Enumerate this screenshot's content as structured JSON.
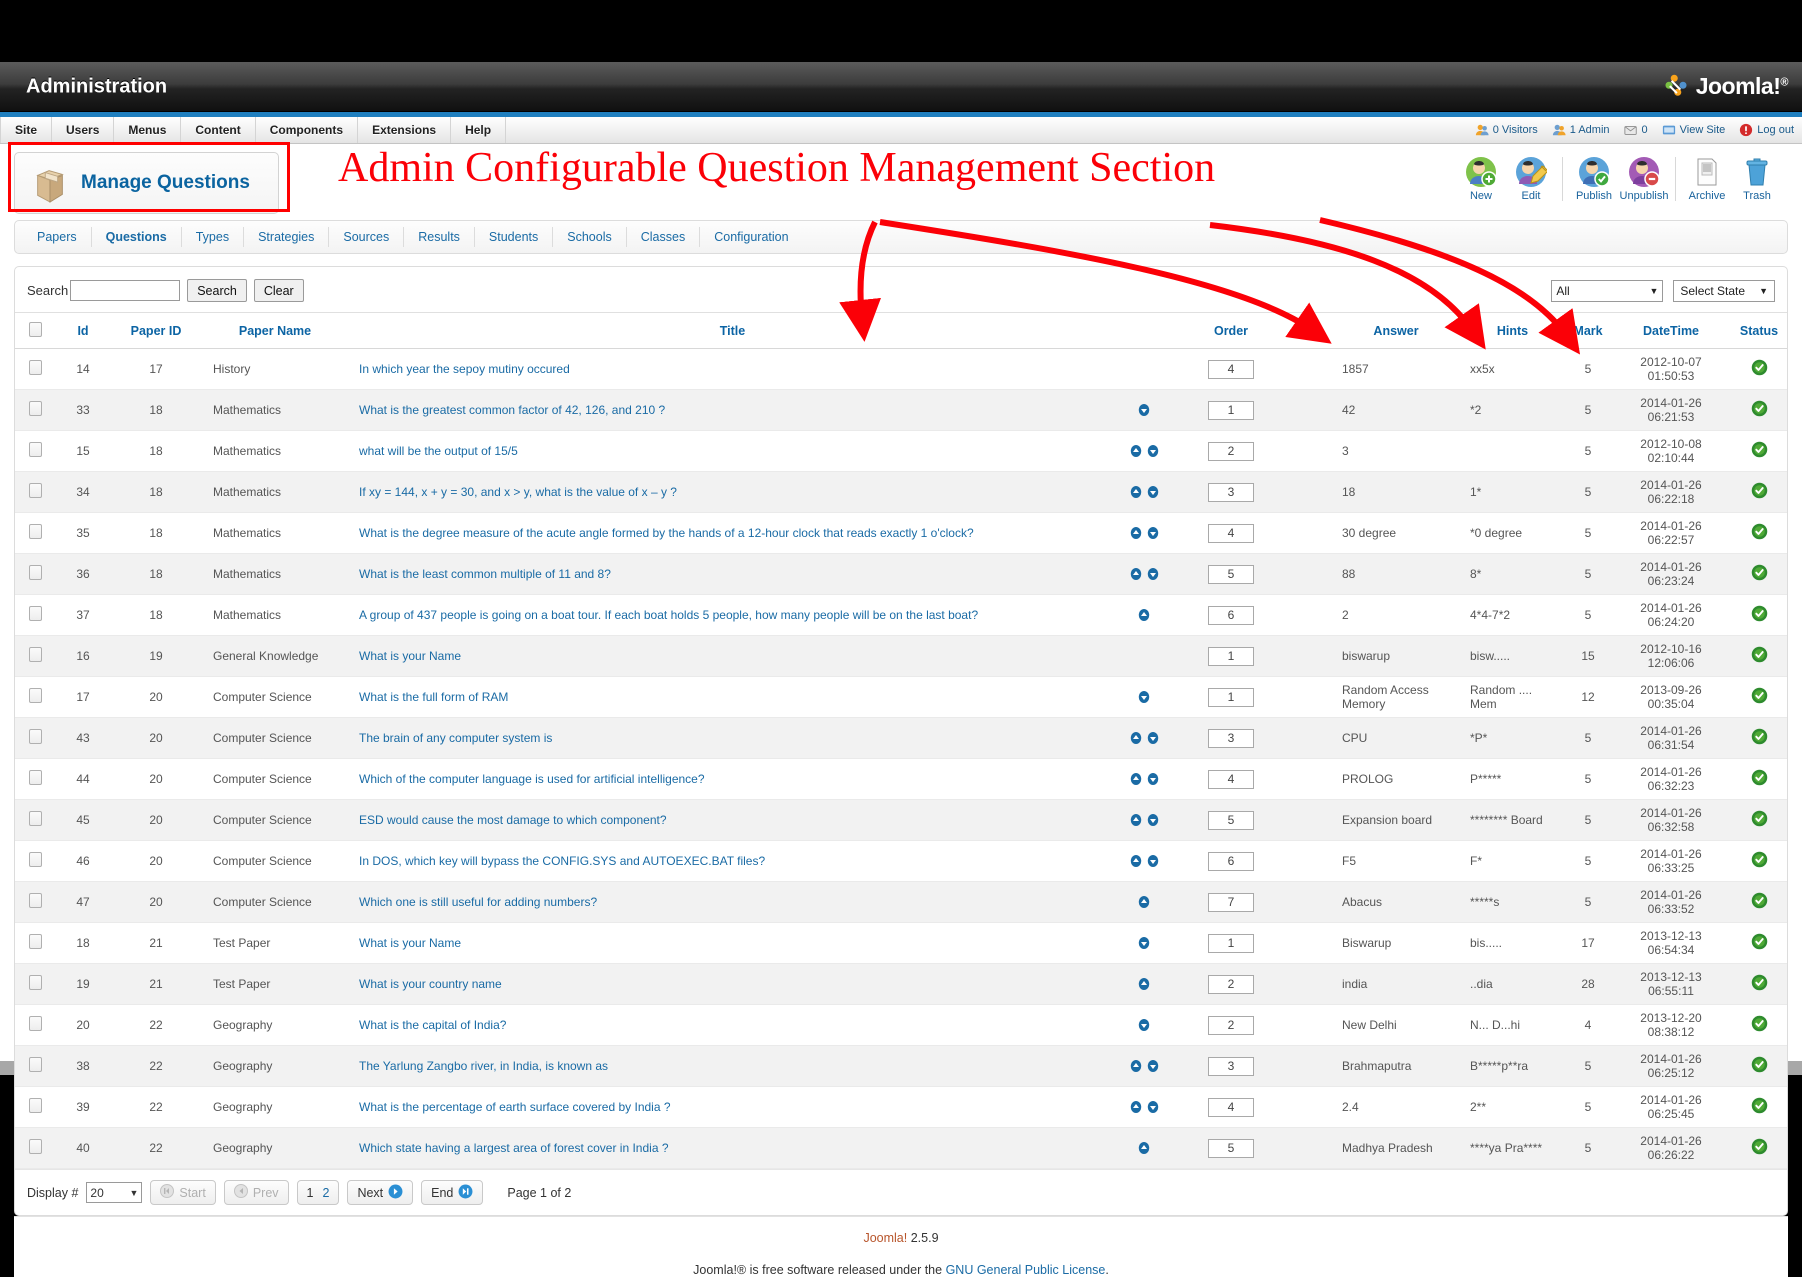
{
  "header": {
    "title": "Administration",
    "brand": "Joomla!",
    "brand_sup": "®"
  },
  "menu": {
    "items": [
      {
        "label": "Site"
      },
      {
        "label": "Users"
      },
      {
        "label": "Menus"
      },
      {
        "label": "Content"
      },
      {
        "label": "Components"
      },
      {
        "label": "Extensions"
      },
      {
        "label": "Help"
      }
    ],
    "status": [
      {
        "label": "0 Visitors",
        "icon": "visitors-icon"
      },
      {
        "label": "1 Admin",
        "icon": "admin-icon"
      },
      {
        "label": "0",
        "icon": "messages-icon"
      },
      {
        "label": "View Site",
        "icon": "view-site-icon"
      },
      {
        "label": "Log out",
        "icon": "logout-icon"
      }
    ]
  },
  "page": {
    "title": "Manage Questions",
    "icon": "box-icon",
    "annotation": "Admin Configurable Question Management Section"
  },
  "toolbar": {
    "buttons": [
      {
        "label": "New",
        "icon": "user-plus-icon"
      },
      {
        "label": "Edit",
        "icon": "user-edit-icon"
      },
      {
        "label": "Publish",
        "icon": "user-check-icon"
      },
      {
        "label": "Unpublish",
        "icon": "user-minus-icon"
      },
      {
        "label": "Archive",
        "icon": "archive-icon"
      },
      {
        "label": "Trash",
        "icon": "trash-icon"
      }
    ]
  },
  "submenu": {
    "tabs": [
      {
        "label": "Papers",
        "active": false
      },
      {
        "label": "Questions",
        "active": true
      },
      {
        "label": "Types",
        "active": false
      },
      {
        "label": "Strategies",
        "active": false
      },
      {
        "label": "Sources",
        "active": false
      },
      {
        "label": "Results",
        "active": false
      },
      {
        "label": "Students",
        "active": false
      },
      {
        "label": "Schools",
        "active": false
      },
      {
        "label": "Classes",
        "active": false
      },
      {
        "label": "Configuration",
        "active": false
      }
    ]
  },
  "filters": {
    "search_label": "Search",
    "search_value": "",
    "search_placeholder": "",
    "search_button": "Search",
    "clear_button": "Clear",
    "paper_select": "All",
    "state_select": "Select State"
  },
  "table": {
    "columns": [
      "",
      "Id",
      "Paper ID",
      "Paper Name",
      "Title",
      "",
      "Order",
      "",
      "Answer",
      "Hints",
      "Mark",
      "DateTime",
      "Status"
    ],
    "headers": {
      "id": "Id",
      "paper_id": "Paper ID",
      "paper_name": "Paper Name",
      "title": "Title",
      "order": "Order",
      "save_icon": "save-order-icon",
      "answer": "Answer",
      "hints": "Hints",
      "mark": "Mark",
      "datetime": "DateTime",
      "status": "Status"
    },
    "rows": [
      {
        "id": "14",
        "paper_id": "17",
        "paper_name": "History",
        "title": "In which year the sepoy mutiny occured",
        "up": false,
        "down": false,
        "order": "4",
        "answer": "1857",
        "hints": "xx5x",
        "mark": "5",
        "datetime": "2012-10-07 01:50:53",
        "status": "published"
      },
      {
        "id": "33",
        "paper_id": "18",
        "paper_name": "Mathematics",
        "title": "What is the greatest common factor of 42, 126, and 210 ?",
        "up": false,
        "down": true,
        "order": "1",
        "answer": "42",
        "hints": "*2",
        "mark": "5",
        "datetime": "2014-01-26 06:21:53",
        "status": "published"
      },
      {
        "id": "15",
        "paper_id": "18",
        "paper_name": "Mathematics",
        "title": "what will be the output of 15/5",
        "up": true,
        "down": true,
        "order": "2",
        "answer": "3",
        "hints": "",
        "mark": "5",
        "datetime": "2012-10-08 02:10:44",
        "status": "published"
      },
      {
        "id": "34",
        "paper_id": "18",
        "paper_name": "Mathematics",
        "title": "If xy = 144, x + y = 30, and x > y, what is the value of x – y ?",
        "up": true,
        "down": true,
        "order": "3",
        "answer": "18",
        "hints": "1*",
        "mark": "5",
        "datetime": "2014-01-26 06:22:18",
        "status": "published"
      },
      {
        "id": "35",
        "paper_id": "18",
        "paper_name": "Mathematics",
        "title": "What is the degree measure of the acute angle formed by the hands of a 12-hour clock that reads exactly 1 o'clock?",
        "up": true,
        "down": true,
        "order": "4",
        "answer": "30 degree",
        "hints": "*0 degree",
        "mark": "5",
        "datetime": "2014-01-26 06:22:57",
        "status": "published"
      },
      {
        "id": "36",
        "paper_id": "18",
        "paper_name": "Mathematics",
        "title": "What is the least common multiple of 11 and 8?",
        "up": true,
        "down": true,
        "order": "5",
        "answer": "88",
        "hints": "8*",
        "mark": "5",
        "datetime": "2014-01-26 06:23:24",
        "status": "published"
      },
      {
        "id": "37",
        "paper_id": "18",
        "paper_name": "Mathematics",
        "title": "A group of 437 people is going on a boat tour. If each boat holds 5 people, how many people will be on the last boat?",
        "up": true,
        "down": false,
        "order": "6",
        "answer": "2",
        "hints": "4*4-7*2",
        "mark": "5",
        "datetime": "2014-01-26 06:24:20",
        "status": "published"
      },
      {
        "id": "16",
        "paper_id": "19",
        "paper_name": "General Knowledge",
        "title": "What is your Name",
        "up": false,
        "down": false,
        "order": "1",
        "answer": "biswarup",
        "hints": "bisw.....",
        "mark": "15",
        "datetime": "2012-10-16 12:06:06",
        "status": "published"
      },
      {
        "id": "17",
        "paper_id": "20",
        "paper_name": "Computer Science",
        "title": "What is the full form of RAM",
        "up": false,
        "down": true,
        "order": "1",
        "answer": "Random Access Memory",
        "hints": "Random .... Mem",
        "mark": "12",
        "datetime": "2013-09-26 00:35:04",
        "status": "published"
      },
      {
        "id": "43",
        "paper_id": "20",
        "paper_name": "Computer Science",
        "title": "The brain of any computer system is",
        "up": true,
        "down": true,
        "order": "3",
        "answer": "CPU",
        "hints": "*P*",
        "mark": "5",
        "datetime": "2014-01-26 06:31:54",
        "status": "published"
      },
      {
        "id": "44",
        "paper_id": "20",
        "paper_name": "Computer Science",
        "title": "Which of the computer language is used for artificial intelligence?",
        "up": true,
        "down": true,
        "order": "4",
        "answer": "PROLOG",
        "hints": "P*****",
        "mark": "5",
        "datetime": "2014-01-26 06:32:23",
        "status": "published"
      },
      {
        "id": "45",
        "paper_id": "20",
        "paper_name": "Computer Science",
        "title": "ESD would cause the most damage to which component?",
        "up": true,
        "down": true,
        "order": "5",
        "answer": "Expansion board",
        "hints": "******** Board",
        "mark": "5",
        "datetime": "2014-01-26 06:32:58",
        "status": "published"
      },
      {
        "id": "46",
        "paper_id": "20",
        "paper_name": "Computer Science",
        "title": "In DOS, which key will bypass the CONFIG.SYS and AUTOEXEC.BAT files?",
        "up": true,
        "down": true,
        "order": "6",
        "answer": "F5",
        "hints": "F*",
        "mark": "5",
        "datetime": "2014-01-26 06:33:25",
        "status": "published"
      },
      {
        "id": "47",
        "paper_id": "20",
        "paper_name": "Computer Science",
        "title": "Which one is still useful for adding numbers?",
        "up": true,
        "down": false,
        "order": "7",
        "answer": "Abacus",
        "hints": "*****s",
        "mark": "5",
        "datetime": "2014-01-26 06:33:52",
        "status": "published"
      },
      {
        "id": "18",
        "paper_id": "21",
        "paper_name": "Test Paper",
        "title": "What is your Name",
        "up": false,
        "down": true,
        "order": "1",
        "answer": "Biswarup",
        "hints": "bis.....",
        "mark": "17",
        "datetime": "2013-12-13 06:54:34",
        "status": "published"
      },
      {
        "id": "19",
        "paper_id": "21",
        "paper_name": "Test Paper",
        "title": "What is your country name",
        "up": true,
        "down": false,
        "order": "2",
        "answer": "india",
        "hints": "..dia",
        "mark": "28",
        "datetime": "2013-12-13 06:55:11",
        "status": "published"
      },
      {
        "id": "20",
        "paper_id": "22",
        "paper_name": "Geography",
        "title": "What is the capital of India?",
        "up": false,
        "down": true,
        "order": "2",
        "answer": "New Delhi",
        "hints": "N... D...hi",
        "mark": "4",
        "datetime": "2013-12-20 08:38:12",
        "status": "published"
      },
      {
        "id": "38",
        "paper_id": "22",
        "paper_name": "Geography",
        "title": "The Yarlung Zangbo river, in India, is known as",
        "up": true,
        "down": true,
        "order": "3",
        "answer": "Brahmaputra",
        "hints": "B*****p**ra",
        "mark": "5",
        "datetime": "2014-01-26 06:25:12",
        "status": "published"
      },
      {
        "id": "39",
        "paper_id": "22",
        "paper_name": "Geography",
        "title": "What is the percentage of earth surface covered by India ?",
        "up": true,
        "down": true,
        "order": "4",
        "answer": "2.4",
        "hints": "2**",
        "mark": "5",
        "datetime": "2014-01-26 06:25:45",
        "status": "published"
      },
      {
        "id": "40",
        "paper_id": "22",
        "paper_name": "Geography",
        "title": "Which state having a largest area of forest cover in India ?",
        "up": true,
        "down": false,
        "order": "5",
        "answer": "Madhya Pradesh",
        "hints": "****ya Pra****",
        "mark": "5",
        "datetime": "2014-01-26 06:26:22",
        "status": "published"
      }
    ]
  },
  "pagination": {
    "display_label": "Display #",
    "display_value": "20",
    "start": "Start",
    "prev": "Prev",
    "pages": [
      "1",
      "2"
    ],
    "current_page": "1",
    "next": "Next",
    "end": "End",
    "page_info": "Page 1 of 2"
  },
  "footer": {
    "version": "Joomla! 2.5.9",
    "version_brand": "Joomla!",
    "version_number": " 2.5.9",
    "license_pre": "Joomla!® is free software released under the ",
    "license_link": "GNU General Public License",
    "license_post": "."
  },
  "colors": {
    "accent_blue": "#1a6ba5",
    "header_blue": "#1f7fbf",
    "annotation_red": "#fb0007",
    "status_green": "#2e8b2e"
  }
}
